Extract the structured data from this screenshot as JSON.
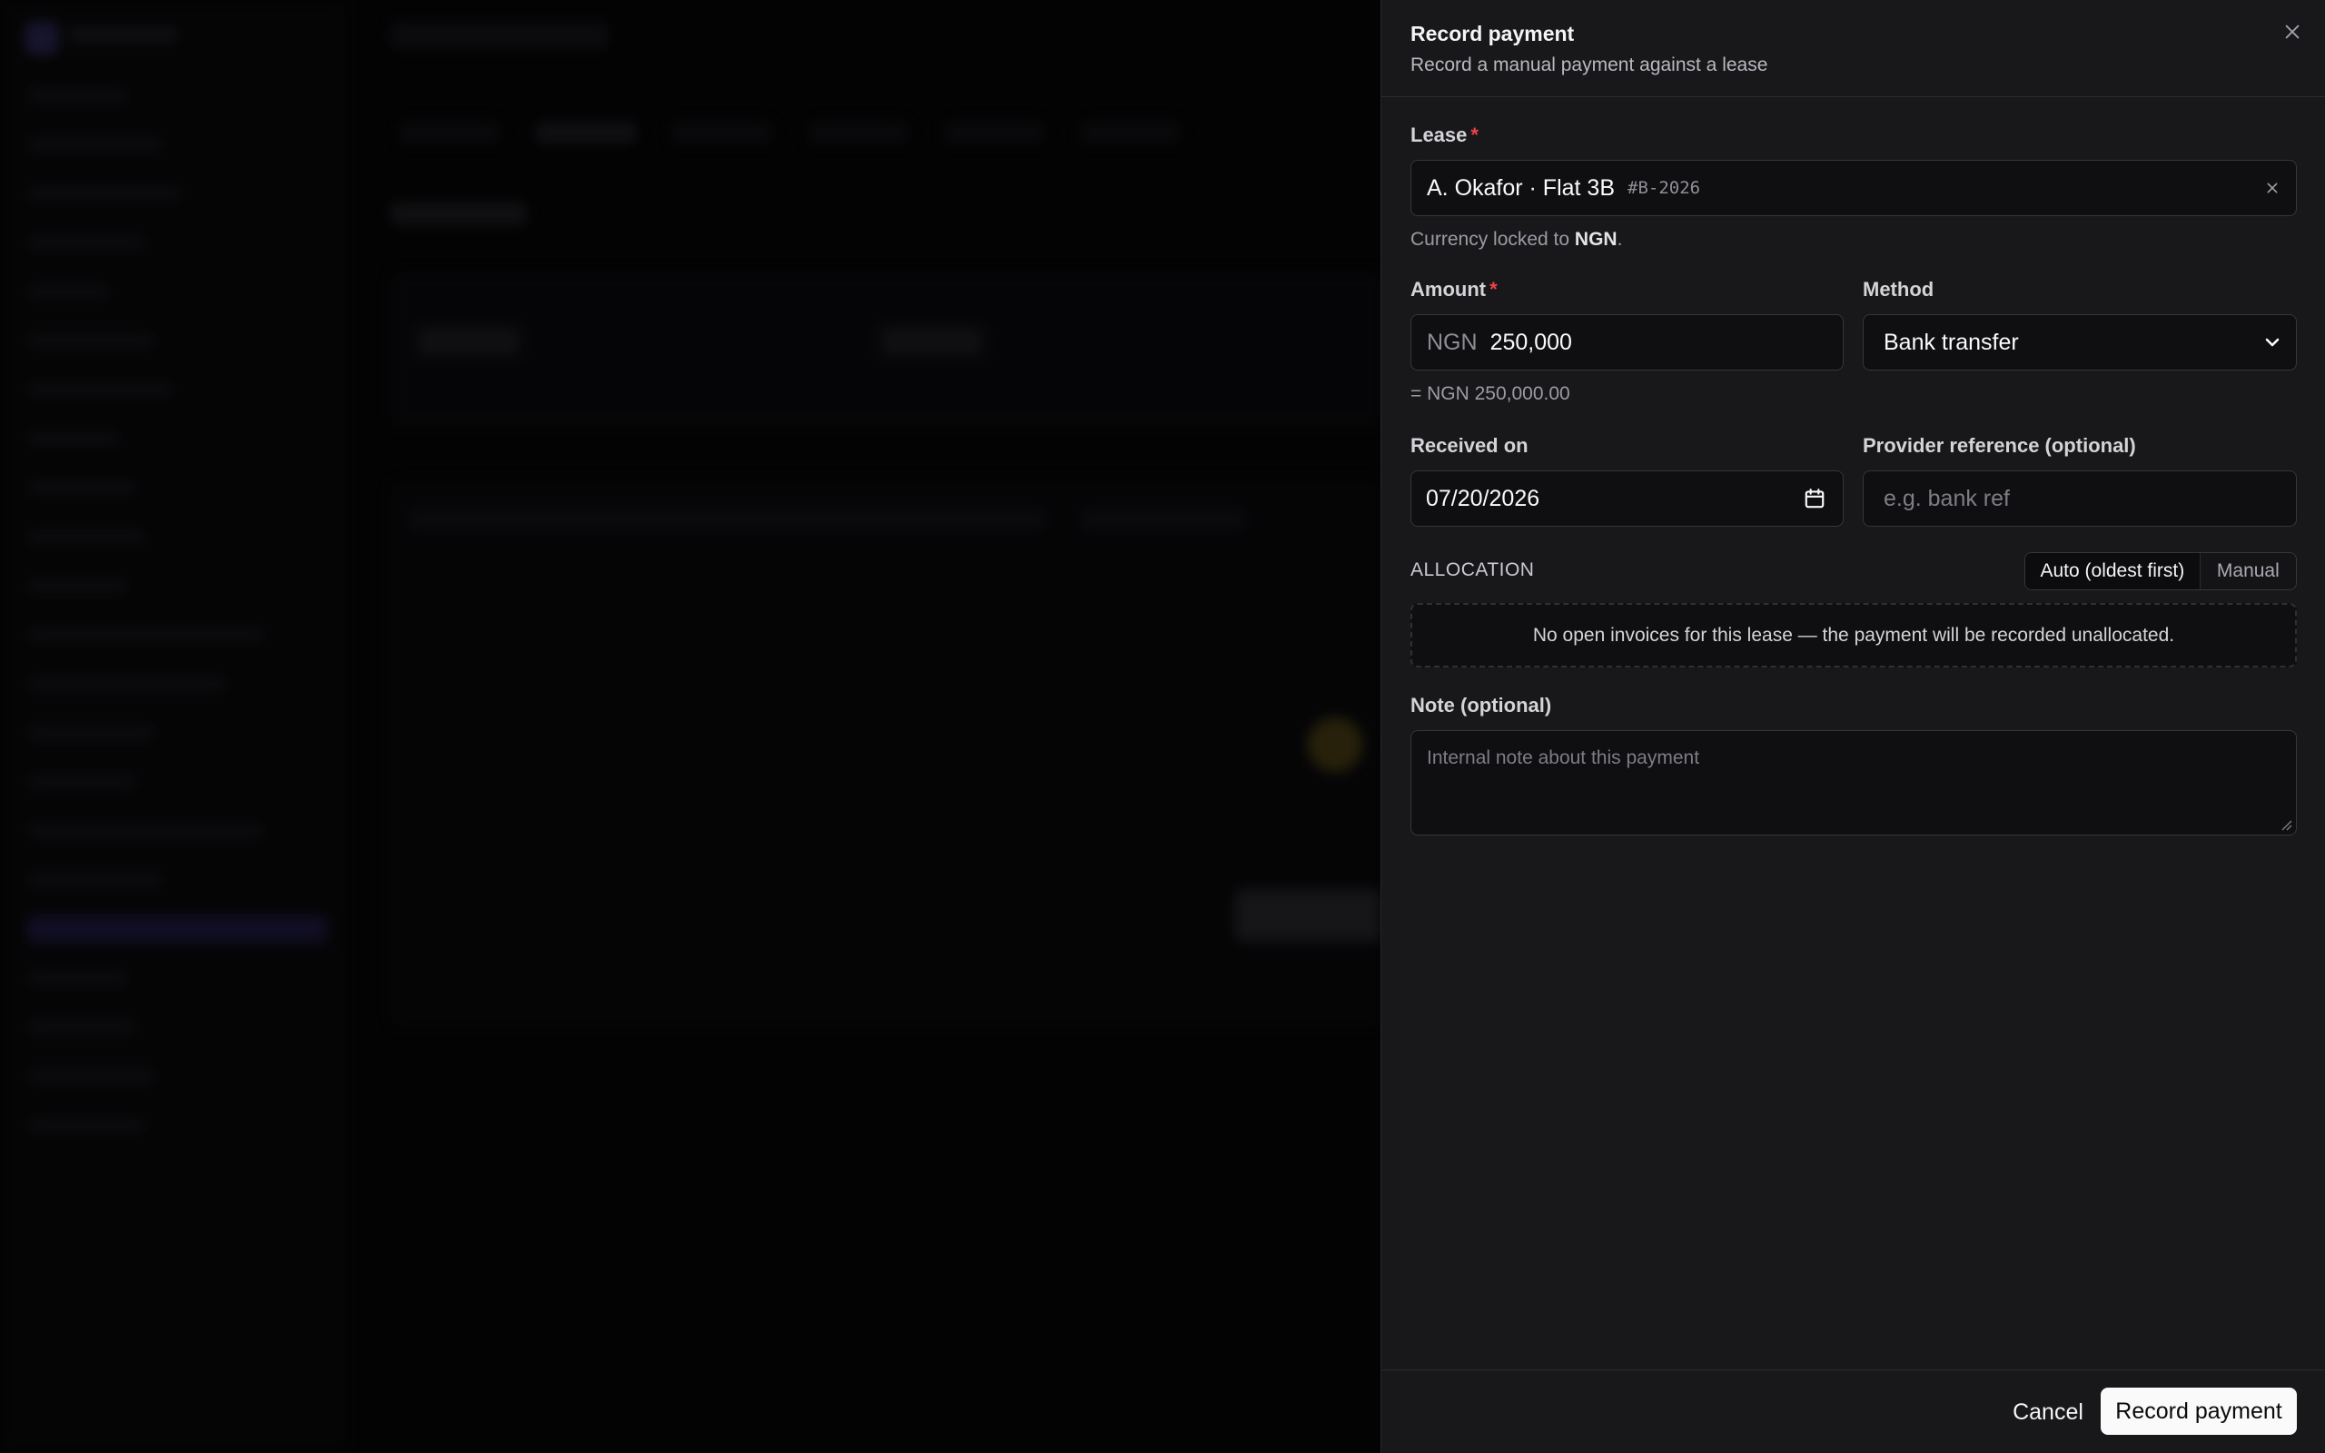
{
  "drawer": {
    "title": "Record payment",
    "subtitle": "Record a manual payment against a lease",
    "close_icon": "close-icon"
  },
  "lease": {
    "label": "Lease",
    "required_mark": "*",
    "selected_name": "A. Okafor · Flat 3B",
    "selected_code": "#B-2026",
    "help_prefix": "Currency locked to ",
    "help_currency": "NGN",
    "help_suffix": "."
  },
  "amount": {
    "label": "Amount",
    "required_mark": "*",
    "currency_prefix": "NGN",
    "value": "250,000",
    "converted": "= NGN 250,000.00"
  },
  "method": {
    "label": "Method",
    "selected": "Bank transfer"
  },
  "received_on": {
    "label": "Received on",
    "value": "07/20/2026"
  },
  "provider_reference": {
    "label": "Provider reference (optional)",
    "placeholder": "e.g. bank ref"
  },
  "allocation": {
    "label": "ALLOCATION",
    "modes": [
      "Auto (oldest first)",
      "Manual"
    ],
    "active_mode": "Auto (oldest first)",
    "empty_message": "No open invoices for this lease — the payment will be recorded unallocated."
  },
  "note": {
    "label": "Note (optional)",
    "placeholder": "Internal note about this payment"
  },
  "footer": {
    "cancel_label": "Cancel",
    "submit_label": "Record payment"
  },
  "colors": {
    "drawer_bg": "#18181b",
    "required": "#ef4444",
    "primary_button_bg": "#fafafa"
  }
}
